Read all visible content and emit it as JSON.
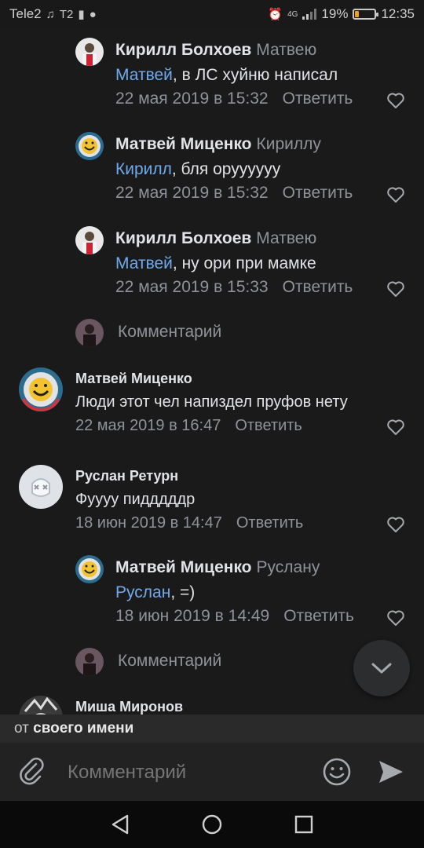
{
  "status_bar": {
    "carrier": "Tele2",
    "carrier2": "T2",
    "network": "4G",
    "battery": "19%",
    "battery_level": 0.19,
    "time": "12:35"
  },
  "comments": [
    {
      "author": "Кирилл Болхоев",
      "reply_to": "Матвею",
      "mention": "Матвей",
      "text": ", в ЛС хуйню написал",
      "date": "22 мая 2019 в 15:32",
      "reply_label": "Ответить"
    },
    {
      "author": "Матвей Миценко",
      "reply_to": "Кириллу",
      "mention": "Кирилл",
      "text": ", бля оруууууу",
      "date": "22 мая 2019 в 15:32",
      "reply_label": "Ответить"
    },
    {
      "author": "Кирилл Болхоев",
      "reply_to": "Матвею",
      "mention": "Матвей",
      "text": ", ну ори при мамке",
      "date": "22 мая 2019 в 15:33",
      "reply_label": "Ответить"
    },
    {
      "author": "Матвей Миценко",
      "text": "Люди этот чел напиздел пруфов нету",
      "date": "22 мая 2019 в 16:47",
      "reply_label": "Ответить"
    },
    {
      "author": "Руслан Ретурн",
      "text": "Фуууу пидддддр",
      "date": "18 июн 2019 в 14:47",
      "reply_label": "Ответить"
    },
    {
      "author": "Матвей Миценко",
      "reply_to": "Руслану",
      "mention": "Руслан",
      "text": ", =)",
      "date": "18 июн 2019 в 14:49",
      "reply_label": "Ответить"
    },
    {
      "author": "Миша Миронов"
    }
  ],
  "write_comment_label": "Комментарий",
  "from_bar": {
    "prefix": "от",
    "value": "своего имени"
  },
  "input": {
    "placeholder": "Комментарий"
  },
  "icons": {
    "like": "heart-icon",
    "attach": "paperclip-icon",
    "emoji": "smile-icon",
    "send": "send-icon",
    "scroll_down": "chevron-down-icon",
    "nav_back": "triangle-back-icon",
    "nav_home": "circle-home-icon",
    "nav_recent": "square-recent-icon"
  },
  "colors": {
    "background": "#1a1a1a",
    "mention": "#71aaeb",
    "secondary_text": "#8f9399",
    "battery": "#f0a020"
  }
}
